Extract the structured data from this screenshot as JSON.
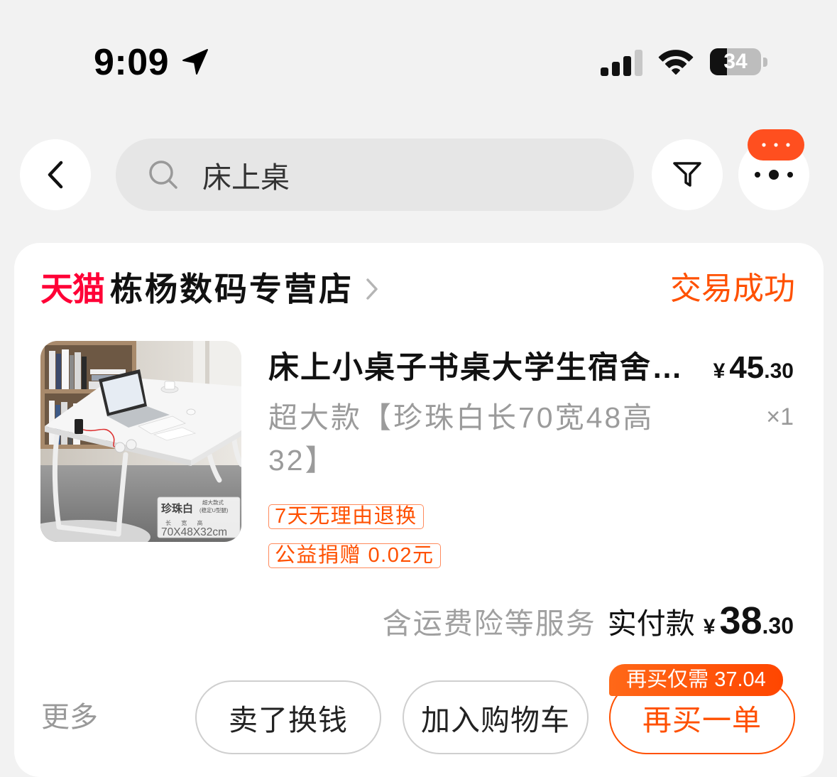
{
  "status_bar": {
    "time": "9:09",
    "battery": "34"
  },
  "search": {
    "query": "床上桌"
  },
  "icons": {
    "location": "location-arrow-icon",
    "signal": "cellular-signal-icon",
    "wifi": "wifi-icon",
    "battery": "battery-icon",
    "back": "chevron-left-icon",
    "search": "search-icon",
    "filter": "filter-icon",
    "more": "more-icon",
    "message_badge": "ellipsis-badge-icon",
    "store_link": "chevron-right-icon"
  },
  "colors": {
    "accent": "#ff5000",
    "brand_red": "#ff0036",
    "page_bg": "#f2f2f2",
    "card_bg": "#ffffff",
    "muted_text": "#999999"
  },
  "order": {
    "platform_logo": "天猫",
    "store_name": "栋杨数码专营店",
    "status": "交易成功",
    "item": {
      "title": "床上小桌子书桌大学生宿舍…",
      "price": {
        "currency": "¥",
        "integer": "45",
        "decimal": ".30"
      },
      "sku_lines": [
        "超大款【珍珠白长70宽48高",
        "32】"
      ],
      "quantity": "×1",
      "tags": [
        "7天无理由退换",
        "公益捐赠 0.02元"
      ],
      "image_label": {
        "color_name": "珍珠白",
        "style": "超大款式",
        "leg_type": "(稳定U型腿)",
        "dimension_headers": "长 宽 高",
        "dimensions": "70X48X32cm"
      }
    },
    "payment": {
      "service_note": "含运费险等服务",
      "paid_label": "实付款",
      "currency": "¥",
      "integer": "38",
      "decimal": ".30"
    },
    "actions": {
      "more": "更多",
      "sell": "卖了换钱",
      "add_to_cart": "加入购物车",
      "buy_again": "再买一单",
      "buy_again_badge": "再买仅需 37.04"
    }
  }
}
